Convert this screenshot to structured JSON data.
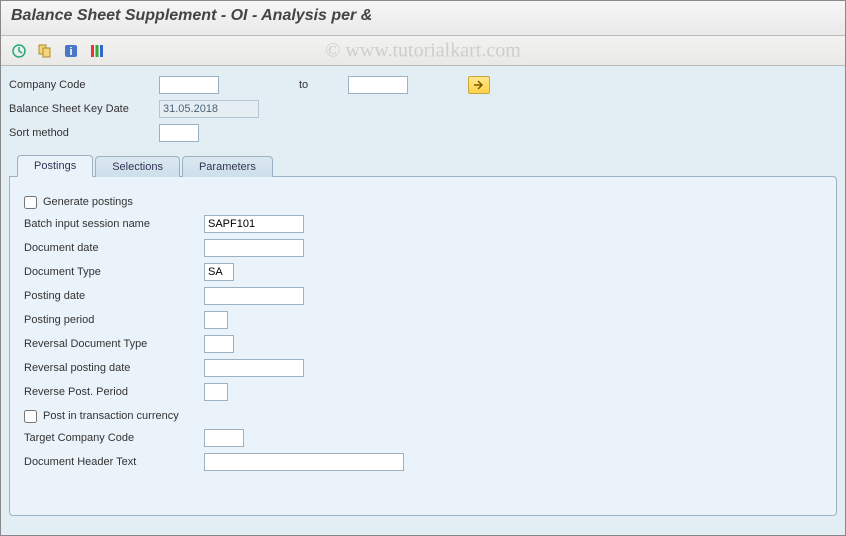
{
  "title": "Balance Sheet Supplement - OI - Analysis per &",
  "watermark": "© www.tutorialkart.com",
  "toolbar": {
    "icons": [
      "execute-icon",
      "variants-icon",
      "info-icon",
      "color-legend-icon"
    ]
  },
  "top": {
    "company_code_label": "Company Code",
    "company_code_value": "",
    "to_label": "to",
    "company_code_to_value": "",
    "key_date_label": "Balance Sheet Key Date",
    "key_date_value": "31.05.2018",
    "sort_method_label": "Sort method",
    "sort_method_value": ""
  },
  "tabs": {
    "postings": "Postings",
    "selections": "Selections",
    "parameters": "Parameters",
    "active": "postings"
  },
  "postings": {
    "generate_label": "Generate postings",
    "generate_checked": false,
    "batch_label": "Batch input session name",
    "batch_value": "SAPF101",
    "doc_date_label": "Document date",
    "doc_date_value": "",
    "doc_type_label": "Document Type",
    "doc_type_value": "SA",
    "posting_date_label": "Posting date",
    "posting_date_value": "",
    "posting_period_label": "Posting period",
    "posting_period_value": "",
    "rev_doc_type_label": "Reversal Document Type",
    "rev_doc_type_value": "",
    "rev_post_date_label": "Reversal posting date",
    "rev_post_date_value": "",
    "rev_post_period_label": "Reverse Post. Period",
    "rev_post_period_value": "",
    "trans_curr_label": "Post in transaction currency",
    "trans_curr_checked": false,
    "target_cc_label": "Target Company Code",
    "target_cc_value": "",
    "header_text_label": "Document Header Text",
    "header_text_value": ""
  }
}
